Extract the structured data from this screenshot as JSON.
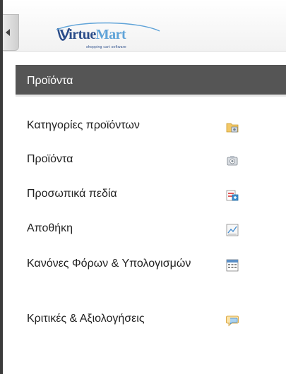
{
  "logo": {
    "brand_part_a": "Virtue",
    "brand_part_b": "Mart",
    "tagline": "shopping cart software"
  },
  "section": {
    "title": "Προϊόντα"
  },
  "menu": {
    "items": [
      {
        "label": "Κατηγορίες προϊόντων",
        "icon": "folder-image-icon"
      },
      {
        "label": "Προϊόντα",
        "icon": "camera-icon"
      },
      {
        "label": "Προσωπικά πεδία",
        "icon": "custom-fields-icon"
      },
      {
        "label": "Αποθήκη",
        "icon": "stock-chart-icon"
      },
      {
        "label": "Κανόνες Φόρων & Υπολογισμών",
        "icon": "calculator-icon"
      },
      {
        "label": "Κριτικές & Αξιολογήσεις",
        "icon": "speech-bubble-icon"
      }
    ]
  },
  "colors": {
    "header_bg": "#555555",
    "logo_blue": "#2b4d8a",
    "logo_light_blue": "#5fa3d8"
  }
}
